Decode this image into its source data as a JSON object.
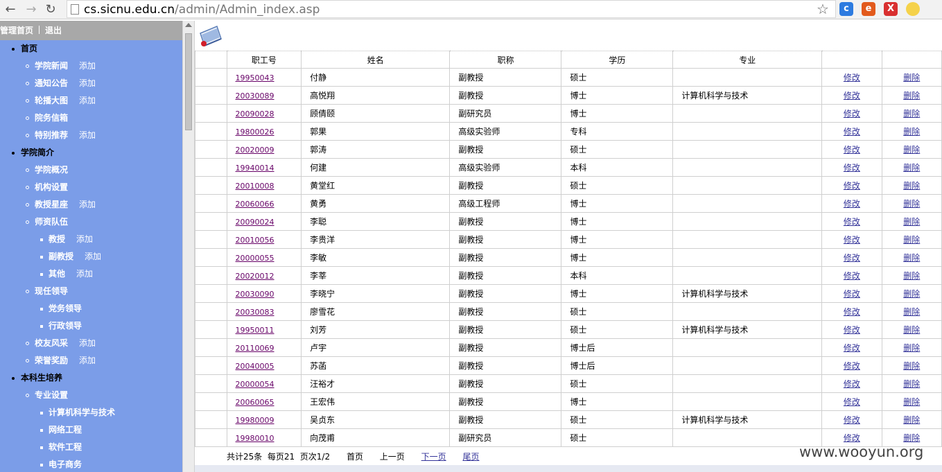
{
  "browser": {
    "url_host": "cs.sicnu.edu.cn",
    "url_path": "/admin/Admin_index.asp"
  },
  "sidebar": {
    "home_link": "管理首页",
    "logout_link": "退出",
    "tree": [
      {
        "level": 0,
        "label": "首页"
      },
      {
        "level": 1,
        "label": "学院新闻",
        "add": "添加"
      },
      {
        "level": 1,
        "label": "通知公告",
        "add": "添加"
      },
      {
        "level": 1,
        "label": "轮播大图",
        "add": "添加"
      },
      {
        "level": 1,
        "label": "院务信箱"
      },
      {
        "level": 1,
        "label": "特别推荐",
        "add": "添加"
      },
      {
        "level": 0,
        "label": "学院简介"
      },
      {
        "level": 1,
        "label": "学院概况"
      },
      {
        "level": 1,
        "label": "机构设置"
      },
      {
        "level": 1,
        "label": "教授星座",
        "add": "添加"
      },
      {
        "level": 1,
        "label": "师资队伍"
      },
      {
        "level": 2,
        "label": "教授",
        "add": "添加"
      },
      {
        "level": 2,
        "label": "副教授",
        "add": "添加"
      },
      {
        "level": 2,
        "label": "其他",
        "add": "添加"
      },
      {
        "level": 1,
        "label": "现任领导"
      },
      {
        "level": 2,
        "label": "党务领导"
      },
      {
        "level": 2,
        "label": "行政领导"
      },
      {
        "level": 1,
        "label": "校友风采",
        "add": "添加"
      },
      {
        "level": 1,
        "label": "荣誉奖励",
        "add": "添加"
      },
      {
        "level": 0,
        "label": "本科生培养"
      },
      {
        "level": 1,
        "label": "专业设置"
      },
      {
        "level": 2,
        "label": "计算机科学与技术"
      },
      {
        "level": 2,
        "label": "网络工程"
      },
      {
        "level": 2,
        "label": "软件工程"
      },
      {
        "level": 2,
        "label": "电子商务"
      }
    ]
  },
  "table": {
    "headers": [
      "职工号",
      "姓名",
      "职称",
      "学历",
      "专业",
      "",
      ""
    ],
    "edit_label": "修改",
    "delete_label": "删除",
    "rows": [
      [
        "19950043",
        "付静",
        "副教授",
        "硕士",
        ""
      ],
      [
        "20030089",
        "高悦翔",
        "副教授",
        "博士",
        "计算机科学与技术"
      ],
      [
        "20090028",
        "顾倩颐",
        "副研究员",
        "博士",
        ""
      ],
      [
        "19800026",
        "郭果",
        "高级实验师",
        "专科",
        ""
      ],
      [
        "20020009",
        "郭涛",
        "副教授",
        "硕士",
        ""
      ],
      [
        "19940014",
        "何建",
        "高级实验师",
        "本科",
        ""
      ],
      [
        "20010008",
        "黄堂红",
        "副教授",
        "硕士",
        ""
      ],
      [
        "20060066",
        "黄勇",
        "高级工程师",
        "博士",
        ""
      ],
      [
        "20090024",
        "李聪",
        "副教授",
        "博士",
        ""
      ],
      [
        "20010056",
        "李贵洋",
        "副教授",
        "博士",
        ""
      ],
      [
        "20000055",
        "李敏",
        "副教授",
        "博士",
        ""
      ],
      [
        "20020012",
        "李莘",
        "副教授",
        "本科",
        ""
      ],
      [
        "20030090",
        "李晓宁",
        "副教授",
        "博士",
        "计算机科学与技术"
      ],
      [
        "20030083",
        "廖雪花",
        "副教授",
        "硕士",
        ""
      ],
      [
        "19950011",
        "刘芳",
        "副教授",
        "硕士",
        "计算机科学与技术"
      ],
      [
        "20110069",
        "卢宇",
        "副教授",
        "博士后",
        ""
      ],
      [
        "20040005",
        "苏菡",
        "副教授",
        "博士后",
        ""
      ],
      [
        "20000054",
        "汪裕才",
        "副教授",
        "硕士",
        ""
      ],
      [
        "20060065",
        "王宏伟",
        "副教授",
        "博士",
        ""
      ],
      [
        "19980009",
        "吴贞东",
        "副教授",
        "硕士",
        "计算机科学与技术"
      ],
      [
        "19980010",
        "向茂甫",
        "副研究员",
        "硕士",
        ""
      ]
    ]
  },
  "pager": {
    "summary": "共计25条  每页21  页次1/2",
    "first": "首页",
    "prev": "上一页",
    "next": "下一页",
    "last": "尾页"
  },
  "watermark": "www.wooyun.org"
}
